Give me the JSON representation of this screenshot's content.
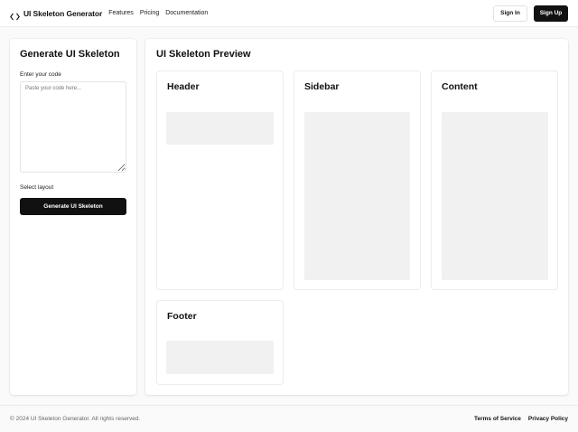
{
  "header": {
    "brand_name": "UI Skeleton Generator",
    "brand_icon": "code-icon",
    "nav": [
      "Features",
      "Pricing",
      "Documentation"
    ],
    "signin_label": "Sign In",
    "signup_label": "Sign Up"
  },
  "generator": {
    "title": "Generate UI Skeleton",
    "code_label": "Enter your code",
    "code_placeholder": "Paste your code here...",
    "code_value": "",
    "layout_label": "Select layout",
    "generate_label": "Generate UI Skeleton"
  },
  "preview": {
    "title": "UI Skeleton Preview",
    "cards": [
      "Header",
      "Sidebar",
      "Content",
      "Footer"
    ]
  },
  "footer": {
    "copyright": "© 2024 UI Skeleton Generator. All rights reserved.",
    "links": [
      "Terms of Service",
      "Privacy Policy"
    ]
  },
  "colors": {
    "primary": "#111111",
    "background": "#fafafa",
    "skeleton": "#f1f1f1",
    "border": "#ececec"
  }
}
